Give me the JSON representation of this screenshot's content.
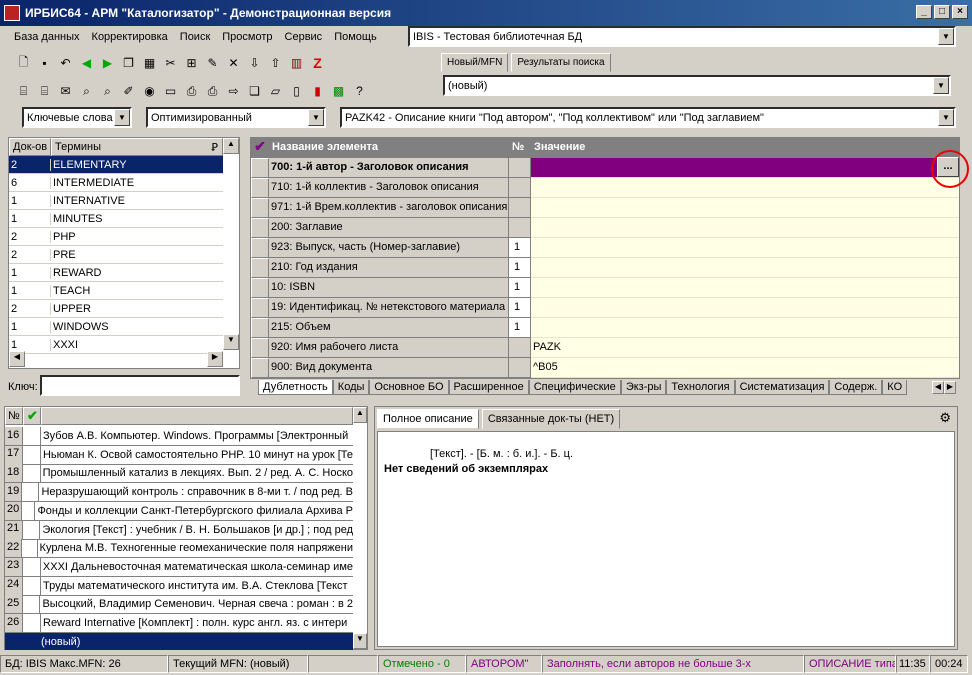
{
  "window": {
    "title": "ИРБИС64 - АРМ \"Каталогизатор\" - Демонстрационная версия"
  },
  "menu": [
    "База данных",
    "Корректировка",
    "Поиск",
    "Просмотр",
    "Сервис",
    "Помощь"
  ],
  "database": {
    "selected": "IBIS - Тестовая библиотечная БД"
  },
  "record_tabs": [
    "Новый/MFN",
    "Результаты поиска"
  ],
  "record_combo": "(новый)",
  "search": {
    "mode": "Ключевые слова",
    "optimize": "Оптимизированный",
    "worksheet": "PAZK42 - Описание книги \"Под автором\", \"Под коллективом\" или \"Под заглавием\""
  },
  "dictionary": {
    "headers": {
      "docs": "Док-ов",
      "terms": "Термины"
    },
    "rows": [
      {
        "docs": "2",
        "term": "ELEMENTARY"
      },
      {
        "docs": "6",
        "term": "INTERMEDIATE"
      },
      {
        "docs": "1",
        "term": "INTERNATIVE"
      },
      {
        "docs": "1",
        "term": "MINUTES"
      },
      {
        "docs": "2",
        "term": "PHP"
      },
      {
        "docs": "2",
        "term": "PRE"
      },
      {
        "docs": "1",
        "term": "REWARD"
      },
      {
        "docs": "1",
        "term": "TEACH"
      },
      {
        "docs": "2",
        "term": "UPPER"
      },
      {
        "docs": "1",
        "term": "WINDOWS"
      },
      {
        "docs": "1",
        "term": "XXXI"
      }
    ],
    "key_label": "Ключ:"
  },
  "editor": {
    "headers": {
      "name": "Название элемента",
      "num": "№",
      "value": "Значение"
    },
    "rows": [
      {
        "name": "700: 1-й  автор - Заголовок описания",
        "num": "",
        "value": ""
      },
      {
        "name": "710: 1-й коллектив - Заголовок описания",
        "num": "",
        "value": ""
      },
      {
        "name": "971: 1-й Врем.коллектив - заголовок описания",
        "num": "",
        "value": ""
      },
      {
        "name": "200: Заглавие",
        "num": "",
        "value": ""
      },
      {
        "name": "923: Выпуск, часть (Номер-заглавие)",
        "num": "1",
        "value": ""
      },
      {
        "name": "210: Год издания",
        "num": "1",
        "value": ""
      },
      {
        "name": "10: ISBN",
        "num": "1",
        "value": ""
      },
      {
        "name": "19: Идентификац. № нетекстового материала",
        "num": "1",
        "value": ""
      },
      {
        "name": "215: Объем",
        "num": "1",
        "value": ""
      },
      {
        "name": "920: Имя рабочего листа",
        "num": "",
        "value": "PAZK"
      },
      {
        "name": "900: Вид документа",
        "num": "",
        "value": "^B05"
      }
    ],
    "ellipsis": "...",
    "tabs": [
      "Дублетность",
      "Коды",
      "Основное БО",
      "Расширенное",
      "Специфические",
      "Экз-ры",
      "Технология",
      "Систематизация",
      "Содерж.",
      "КО"
    ]
  },
  "results": {
    "header_num": "№",
    "rows": [
      {
        "n": "16",
        "text": "Зубов А.В. Компьютер. Windows. Программы [Электронный"
      },
      {
        "n": "17",
        "text": "Ньюман К. Освой самостоятельно PHP. 10 минут на урок [Те"
      },
      {
        "n": "18",
        "text": "Промышленный катализ в лекциях. Вып. 2 / ред. А. С. Носко"
      },
      {
        "n": "19",
        "text": "Неразрушающий контроль : справочник в 8-ми т. / под ред. В"
      },
      {
        "n": "20",
        "text": "Фонды и коллекции Санкт-Петербургского филиала Архива Р"
      },
      {
        "n": "21",
        "text": "Экология [Текст] : учебник / В. Н. Большаков [и др.] ; под ред"
      },
      {
        "n": "22",
        "text": "Курлена М.В. Техногенные геомеханические поля напряжени"
      },
      {
        "n": "23",
        "text": "XXXI Дальневосточная математическая школа-семинар име"
      },
      {
        "n": "24",
        "text": "Труды математического института им. В.А. Стеклова [Текст"
      },
      {
        "n": "25",
        "text": "Высоцкий, Владимир Семенович. Черная свеча : роман : в 2"
      },
      {
        "n": "26",
        "text": "Reward Internative [Комплект] : полн. курс англ. яз. с интери"
      }
    ],
    "new_row": "(новый)"
  },
  "preview": {
    "tabs": [
      "Полное описание",
      "Связанные док-ты (НЕТ)"
    ],
    "line1": "[Текст]. - [Б. м. : б. и.]. - Б. ц.",
    "line2": "Нет сведений об экземплярах"
  },
  "status": {
    "db": "БД: IBIS Макс.MFN: 26",
    "mfn": "Текущий MFN: (новый)",
    "marked": "Отмечено - 0",
    "tag": "АВТОРОМ\"",
    "hint": "Заполнять, если авторов не больше 3-х",
    "desc": "ОПИСАНИЕ типа",
    "time1": "11:35",
    "time2": "00:24"
  },
  "colors": {
    "titlebar": "#0a246a",
    "selected": "#0a246a",
    "editor_header": "#808080",
    "active_row": "#800080",
    "value_bg": "#ffffe6",
    "status_green": "#008000",
    "status_purple": "#800080"
  }
}
